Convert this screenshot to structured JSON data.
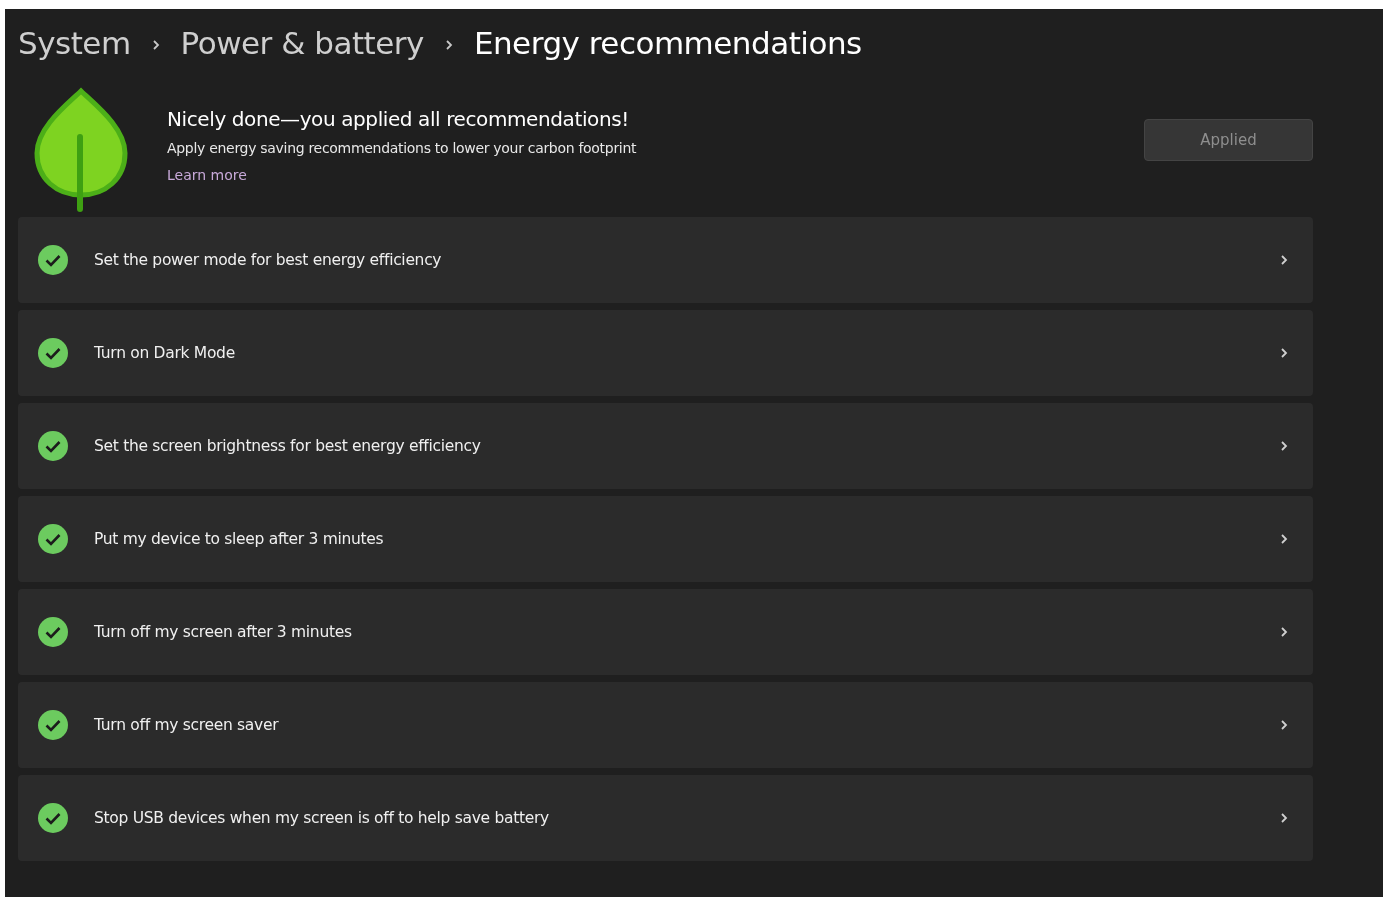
{
  "breadcrumb": [
    {
      "label": "System",
      "selected": false
    },
    {
      "label": "Power & battery",
      "selected": false
    },
    {
      "label": "Energy recommendations",
      "selected": true
    }
  ],
  "banner": {
    "title": "Nicely done—you applied all recommendations!",
    "subtitle": "Apply energy saving recommendations to lower your carbon footprint",
    "link": "Learn more",
    "button": {
      "label": "Applied",
      "disabled": true
    }
  },
  "recommendations": [
    {
      "label": "Set the power mode for best energy efficiency",
      "applied": true
    },
    {
      "label": "Turn on Dark Mode",
      "applied": true
    },
    {
      "label": "Set the screen brightness for best energy efficiency",
      "applied": true
    },
    {
      "label": "Put my device to sleep after 3 minutes",
      "applied": true
    },
    {
      "label": "Turn off my screen after 3 minutes",
      "applied": true
    },
    {
      "label": "Turn off my screen saver",
      "applied": true
    },
    {
      "label": "Stop USB devices when my screen is off to help save battery",
      "applied": true
    }
  ]
}
